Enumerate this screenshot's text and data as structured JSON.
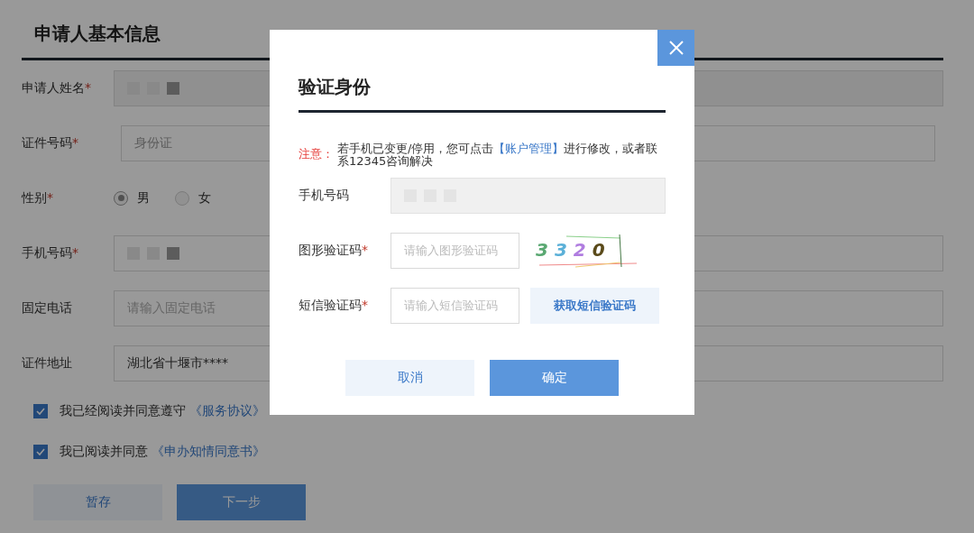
{
  "form": {
    "title": "申请人基本信息",
    "fields": [
      {
        "kind": "input",
        "label": "申请人姓名",
        "required_mark": "*",
        "disabled": true,
        "blurred": true
      },
      {
        "kind": "input",
        "label": "证件号码",
        "required_mark": "*",
        "value": "身份证",
        "muted": true
      },
      {
        "kind": "radio",
        "label": "性别",
        "required_mark": "*",
        "options": [
          {
            "label": "男",
            "selected": true
          },
          {
            "label": "女",
            "selected": false
          }
        ]
      },
      {
        "kind": "input",
        "label": "手机号码",
        "required_mark": "*",
        "blurred": true
      },
      {
        "kind": "input",
        "label": "固定电话",
        "placeholder": "请输入固定电话"
      },
      {
        "kind": "input",
        "label": "证件地址",
        "value": "湖北省十堰市****"
      }
    ],
    "agreements": [
      {
        "text": "我已经阅读并同意遵守",
        "link": "《服务协议》",
        "checked": true
      },
      {
        "text": "我已阅读并同意",
        "link": "《申办知情同意书》",
        "checked": true
      }
    ],
    "buttons": [
      {
        "label": "暂存",
        "kind": "secondary"
      },
      {
        "label": "下一步",
        "kind": "primary"
      }
    ]
  },
  "dialog": {
    "title": "验证身份",
    "notice": {
      "label": "注意：",
      "before": "若手机已变更/停用，您可点击",
      "link": "【账户管理】",
      "after": "进行修改，或者联系12345咨询解决"
    },
    "rows": [
      {
        "kind": "readonly",
        "label": "手机号码"
      },
      {
        "kind": "captcha",
        "label": "图形验证码",
        "required_mark": "*",
        "placeholder": "请输入图形验证码",
        "captcha": "3 3 2 0"
      },
      {
        "kind": "sms",
        "label": "短信验证码",
        "required_mark": "*",
        "placeholder": "请输入短信验证码",
        "action": "获取短信验证码"
      }
    ],
    "buttons": [
      {
        "label": "取消",
        "kind": "secondary"
      },
      {
        "label": "确定",
        "kind": "primary"
      }
    ]
  }
}
